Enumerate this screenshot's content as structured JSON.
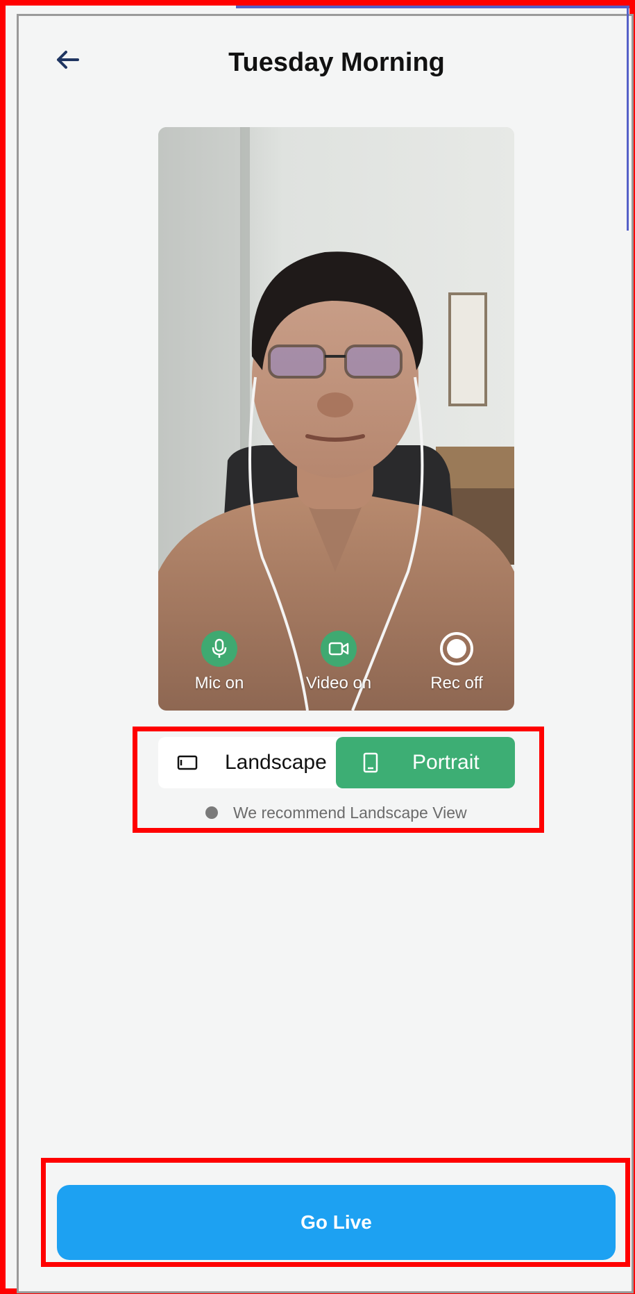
{
  "header": {
    "title": "Tuesday Morning",
    "back_icon": "arrow-left-icon"
  },
  "preview": {
    "controls": [
      {
        "label": "Mic on",
        "icon": "microphone-icon",
        "state": "on"
      },
      {
        "label": "Video on",
        "icon": "video-camera-icon",
        "state": "on"
      },
      {
        "label": "Rec off",
        "icon": "record-icon",
        "state": "off"
      }
    ]
  },
  "orientation": {
    "options": [
      {
        "label": "Landscape",
        "icon": "landscape-icon",
        "selected": false
      },
      {
        "label": "Portrait",
        "icon": "portrait-icon",
        "selected": true
      }
    ],
    "hint": "We recommend Landscape View"
  },
  "actions": {
    "go_live_label": "Go Live"
  },
  "colors": {
    "accent_green": "#3dae74",
    "go_live_blue": "#1da1f2",
    "background": "#f4f5f5",
    "highlight_red": "#ff0000"
  }
}
